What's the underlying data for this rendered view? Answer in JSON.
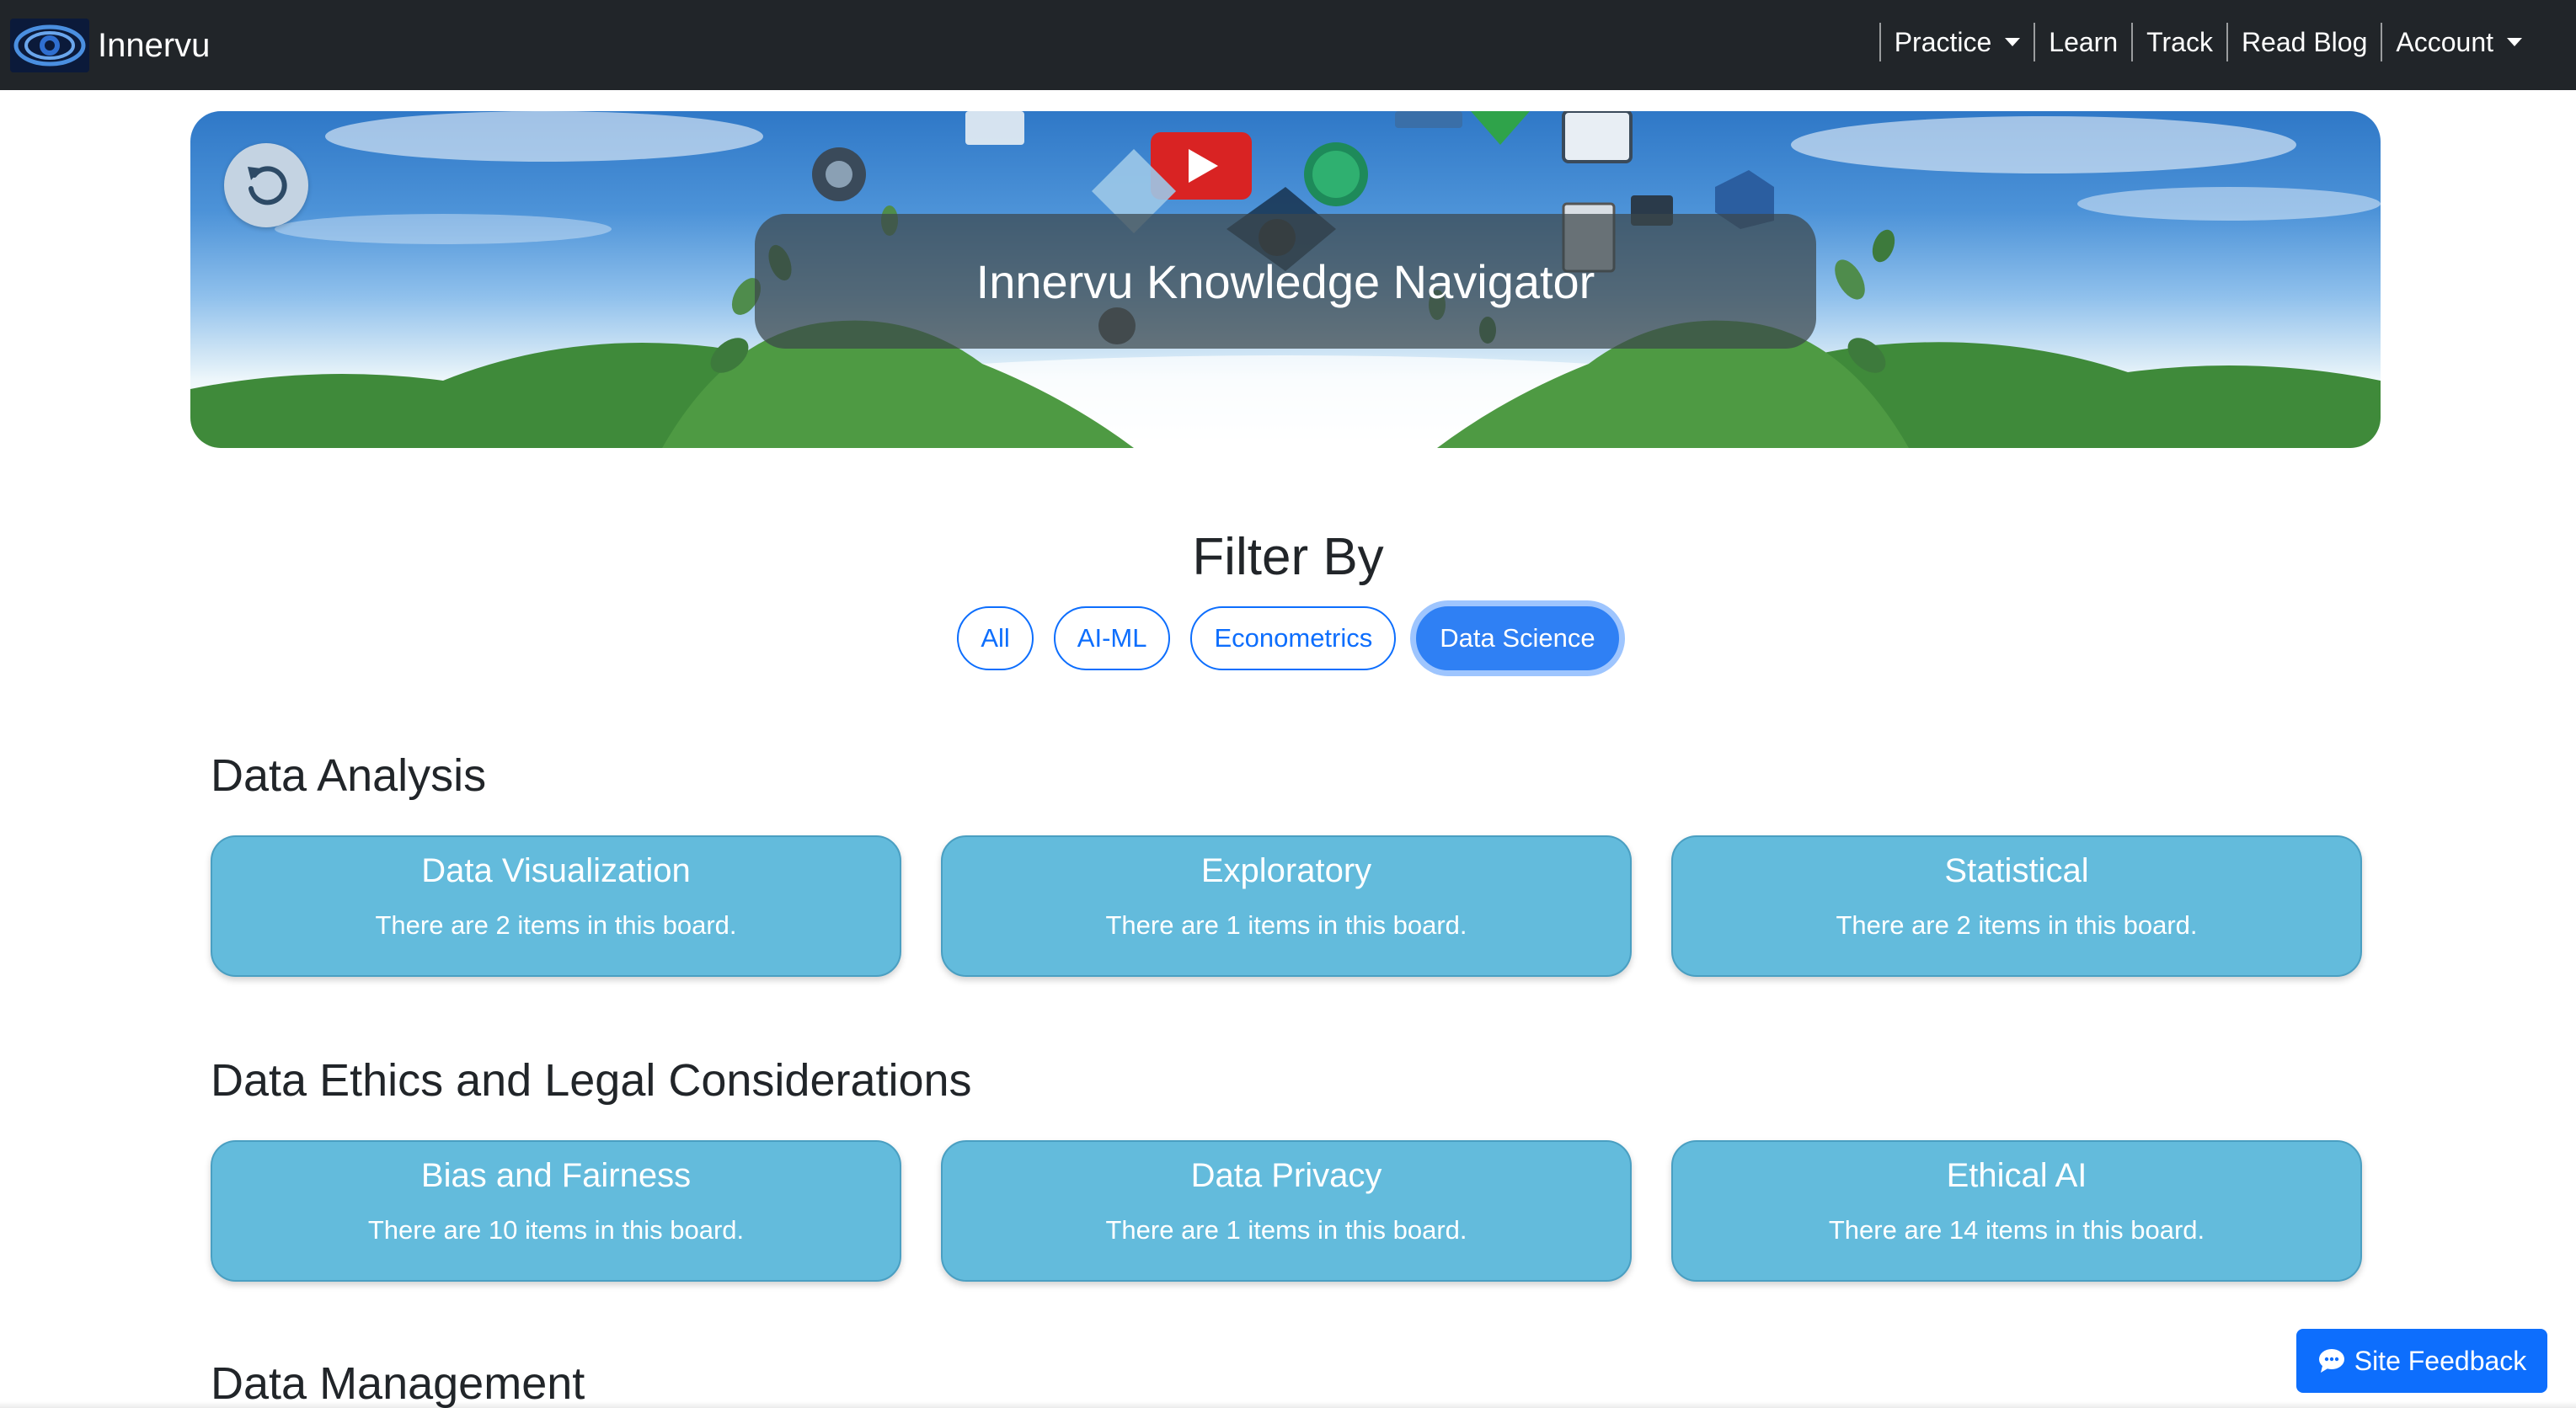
{
  "navbar": {
    "brand": "Innervu",
    "items": [
      {
        "label": "Practice",
        "dropdown": true
      },
      {
        "label": "Learn",
        "dropdown": false
      },
      {
        "label": "Track",
        "dropdown": false
      },
      {
        "label": "Read Blog",
        "dropdown": false
      },
      {
        "label": "Account",
        "dropdown": true
      }
    ]
  },
  "hero": {
    "title": "Innervu Knowledge Navigator",
    "reset_icon": "rotate-ccw-icon"
  },
  "filter": {
    "heading": "Filter By",
    "options": [
      {
        "label": "All",
        "active": false
      },
      {
        "label": "AI-ML",
        "active": false
      },
      {
        "label": "Econometrics",
        "active": false
      },
      {
        "label": "Data Science",
        "active": true
      }
    ]
  },
  "sections": [
    {
      "title": "Data Analysis",
      "cards": [
        {
          "title": "Data Visualization",
          "subtitle": "There are 2 items in this board."
        },
        {
          "title": "Exploratory",
          "subtitle": "There are 1 items in this board."
        },
        {
          "title": "Statistical",
          "subtitle": "There are 2 items in this board."
        }
      ]
    },
    {
      "title": "Data Ethics and Legal Considerations",
      "cards": [
        {
          "title": "Bias and Fairness",
          "subtitle": "There are 10 items in this board."
        },
        {
          "title": "Data Privacy",
          "subtitle": "There are 1 items in this board."
        },
        {
          "title": "Ethical AI",
          "subtitle": "There are 14 items in this board."
        }
      ]
    },
    {
      "title": "Data Management",
      "cards": []
    }
  ],
  "feedback": {
    "label": "Site Feedback",
    "icon": "chat-bubble-icon"
  },
  "colors": {
    "navbar": "#212529",
    "accent": "#0d6efd",
    "card": "#63bbdc"
  }
}
